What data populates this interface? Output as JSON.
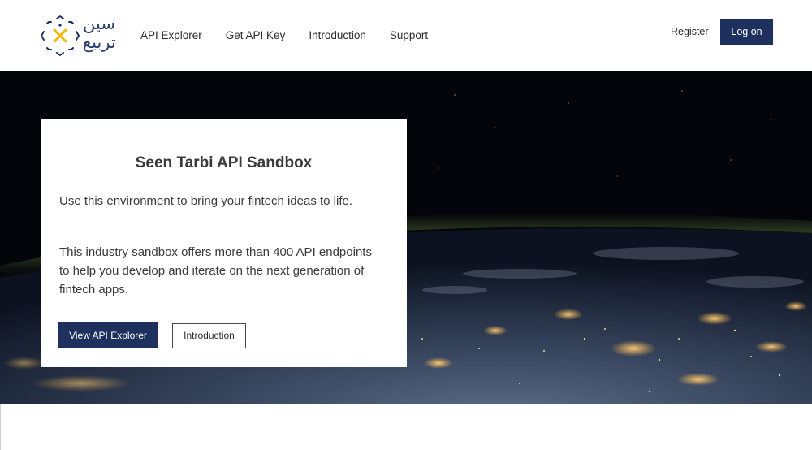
{
  "brand": {
    "logo_line1": "سين",
    "logo_line2": "تربيع",
    "colors": {
      "navy": "#1e305e",
      "gold": "#f2b705",
      "text": "#2a3b6e"
    }
  },
  "nav": {
    "items": [
      "API Explorer",
      "Get API Key",
      "Introduction",
      "Support"
    ]
  },
  "account": {
    "register_label": "Register",
    "logon_label": "Log on"
  },
  "hero": {
    "background": "earth-at-night-from-orbit",
    "title": "Seen Tarbi API Sandbox",
    "intro": "Use this environment to bring your fintech ideas to life.",
    "description": "This industry sandbox offers more than 400 API endpoints to help you develop and iterate on the next generation of fintech apps.",
    "primary_button": "View API Explorer",
    "secondary_button": "Introduction"
  }
}
